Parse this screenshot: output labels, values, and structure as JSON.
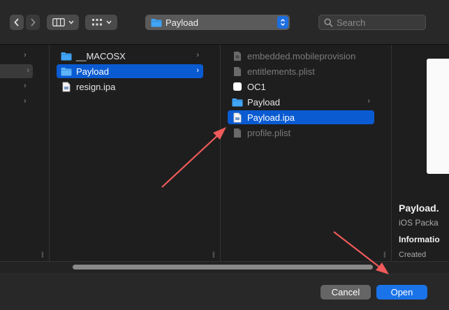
{
  "toolbar": {
    "path_label": "Payload",
    "search_placeholder": "Search"
  },
  "columns": {
    "col2": [
      {
        "name": "__MACOSX",
        "icon": "folder-icon",
        "has_children": true,
        "selected": false
      },
      {
        "name": "Payload",
        "icon": "folder-icon",
        "has_children": true,
        "selected": true
      },
      {
        "name": "resign.ipa",
        "icon": "document-icon",
        "has_children": false,
        "selected": false
      }
    ],
    "col3": [
      {
        "name": "embedded.mobileprovision",
        "icon": "document-icon",
        "dim": true
      },
      {
        "name": "entitlements.plist",
        "icon": "document-icon",
        "dim": true
      },
      {
        "name": "OC1",
        "icon": "white-square-icon",
        "dim": false
      },
      {
        "name": "Payload",
        "icon": "folder-icon",
        "dim": false,
        "has_children": true
      },
      {
        "name": "Payload.ipa",
        "icon": "document-icon",
        "dim": false,
        "selected": true
      },
      {
        "name": "profile.plist",
        "icon": "document-icon",
        "dim": true
      }
    ]
  },
  "preview": {
    "name": "Payload.",
    "kind": "iOS Packa",
    "info_heading": "Informatio",
    "created_label": "Created"
  },
  "footer": {
    "cancel_label": "Cancel",
    "open_label": "Open"
  },
  "colors": {
    "selection": "#0a5bd1",
    "folder": "#41a4f5",
    "accent_button": "#1a73e8",
    "annotation_arrow": "#f05a5a"
  }
}
